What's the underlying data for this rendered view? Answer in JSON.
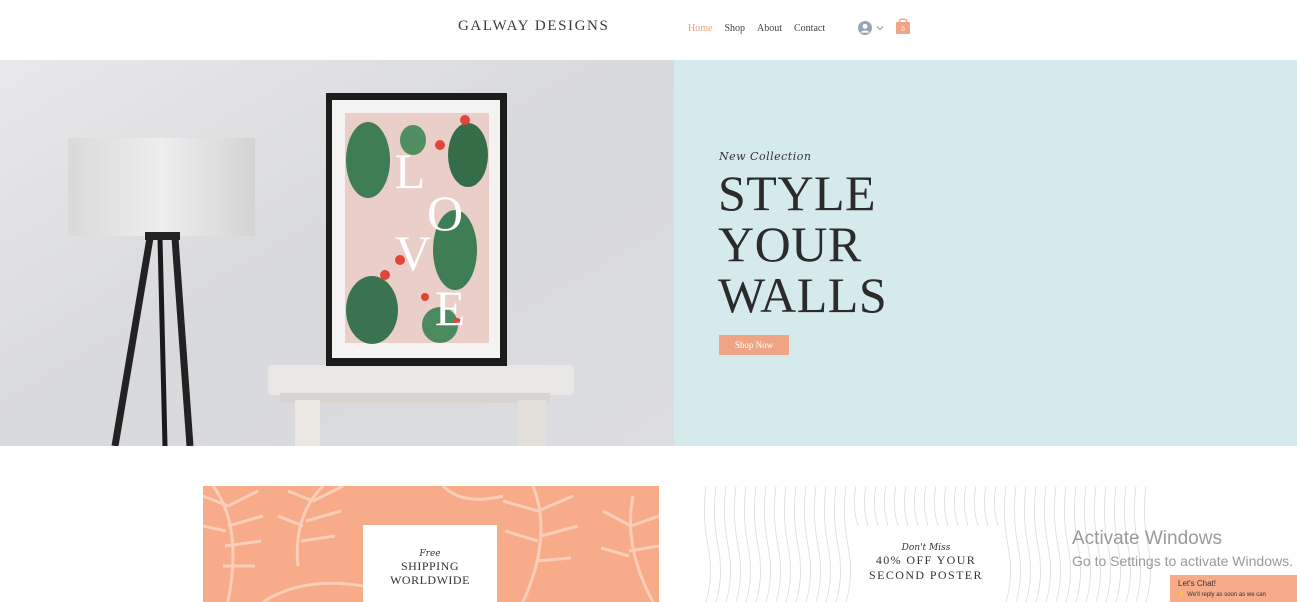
{
  "header": {
    "logo": "GALWAY DESIGNS",
    "nav": [
      {
        "label": "Home",
        "active": true
      },
      {
        "label": "Shop",
        "active": false
      },
      {
        "label": "About",
        "active": false
      },
      {
        "label": "Contact",
        "active": false
      }
    ],
    "user_icon": "user-avatar-icon",
    "cart_icon": "shopping-bag-icon",
    "cart_count": "0"
  },
  "hero": {
    "eyebrow": "New Collection",
    "headline": [
      "STYLE",
      "YOUR",
      "WALLS"
    ],
    "cta_label": "Shop Now",
    "poster_letters": [
      "L",
      "O",
      "V",
      "E"
    ]
  },
  "promos": [
    {
      "script": "Free",
      "title": [
        "SHIPPING",
        "WORLDWIDE"
      ]
    },
    {
      "script": "Don't Miss",
      "title": [
        "40% OFF YOUR",
        "SECOND POSTER"
      ]
    }
  ],
  "os_overlay": {
    "line1": "Activate Windows",
    "line2": "Go to Settings to activate Windows."
  },
  "chat": {
    "title": "Let's Chat!",
    "subtitle": "We'll reply as soon as we can"
  },
  "colors": {
    "accent": "#f0a486",
    "nav_active": "#f0a07d",
    "hero_right_bg": "#d4eaed",
    "promo_peach": "#f7ab89",
    "teal_bar": "#aee0e3"
  }
}
